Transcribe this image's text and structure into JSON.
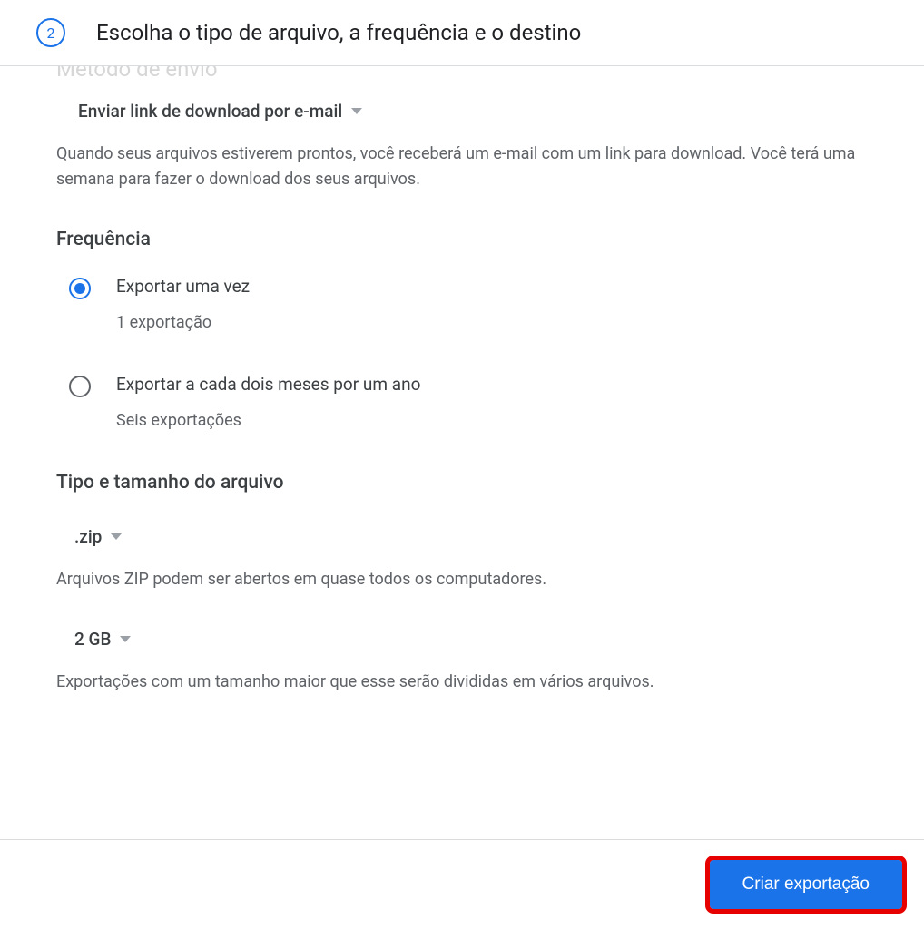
{
  "step": {
    "number": "2",
    "title": "Escolha o tipo de arquivo, a frequência e o destino"
  },
  "ghost_heading": "Método de envio",
  "delivery": {
    "selected": "Enviar link de download por e-mail",
    "description": "Quando seus arquivos estiverem prontos, você receberá um e-mail com um link para download. Você terá uma semana para fazer o download dos seus arquivos."
  },
  "frequency": {
    "heading": "Frequência",
    "options": [
      {
        "label": "Exportar uma vez",
        "sub": "1 exportação",
        "selected": true
      },
      {
        "label": "Exportar a cada dois meses por um ano",
        "sub": "Seis exportações",
        "selected": false
      }
    ]
  },
  "filetype": {
    "heading": "Tipo e tamanho do arquivo",
    "type_selected": ".zip",
    "type_description": "Arquivos ZIP podem ser abertos em quase todos os computadores.",
    "size_selected": "2 GB",
    "size_description": "Exportações com um tamanho maior que esse serão divididas em vários arquivos."
  },
  "footer": {
    "create_label": "Criar exportação"
  }
}
